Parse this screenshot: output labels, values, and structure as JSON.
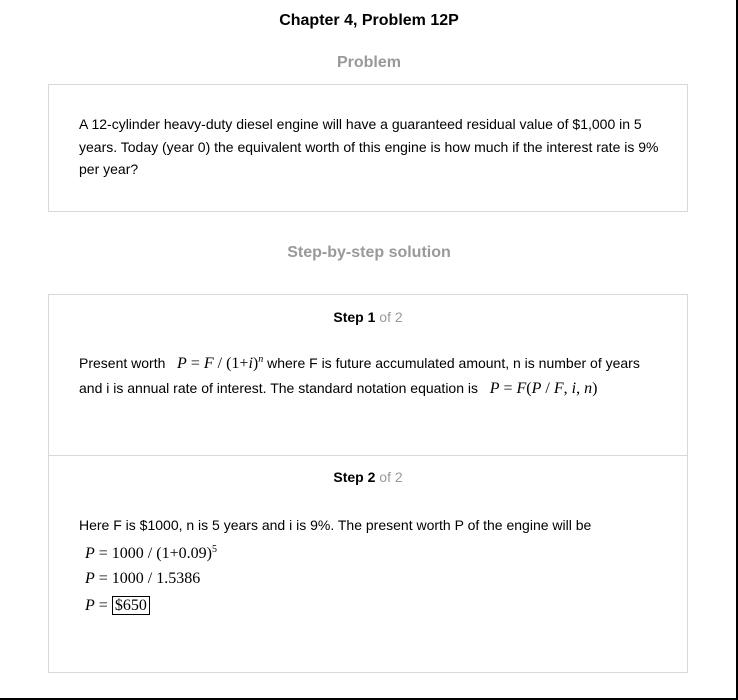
{
  "header": {
    "title": "Chapter 4, Problem 12P"
  },
  "problem": {
    "heading": "Problem",
    "text": "A 12-cylinder heavy-duty diesel engine will have a guaranteed residual value of $1,000 in 5 years. Today (year 0) the equivalent worth of this engine is how much if the interest rate is 9% per year?"
  },
  "solution": {
    "heading": "Step-by-step solution",
    "steps": [
      {
        "step_word": "Step",
        "step_num": "1",
        "of_text": "of 2",
        "text_a": "Present worth",
        "formula_a": {
          "lhs": "P",
          "eq": " = ",
          "F": "F",
          "slash": " / (1+",
          "i": "i",
          "close": ")",
          "exp": "n"
        },
        "text_b": "where F is future accumulated amount, n is number of years",
        "text_c": "and i is annual rate of interest. The standard notation equation is",
        "formula_b": {
          "lhs": "P",
          "eq": " = ",
          "F": "F",
          "paren_open": "(",
          "P": "P",
          "slash": " / ",
          "F2": "F",
          "comma1": ", ",
          "i": "i",
          "comma2": ", ",
          "n": "n",
          "paren_close": ")"
        }
      },
      {
        "step_word": "Step",
        "step_num": "2",
        "of_text": "of 2",
        "text": "Here F is $1000, n is 5 years and i is 9%. The present worth P of the engine will be",
        "equations": [
          {
            "lhs": "P",
            "rhs": " = 1000 / (1+0.09)",
            "exp": "5"
          },
          {
            "lhs": "P",
            "rhs": " = 1000 / 1.5386"
          },
          {
            "lhs": "P",
            "rhs": " = ",
            "answer": "$650"
          }
        ]
      }
    ]
  }
}
